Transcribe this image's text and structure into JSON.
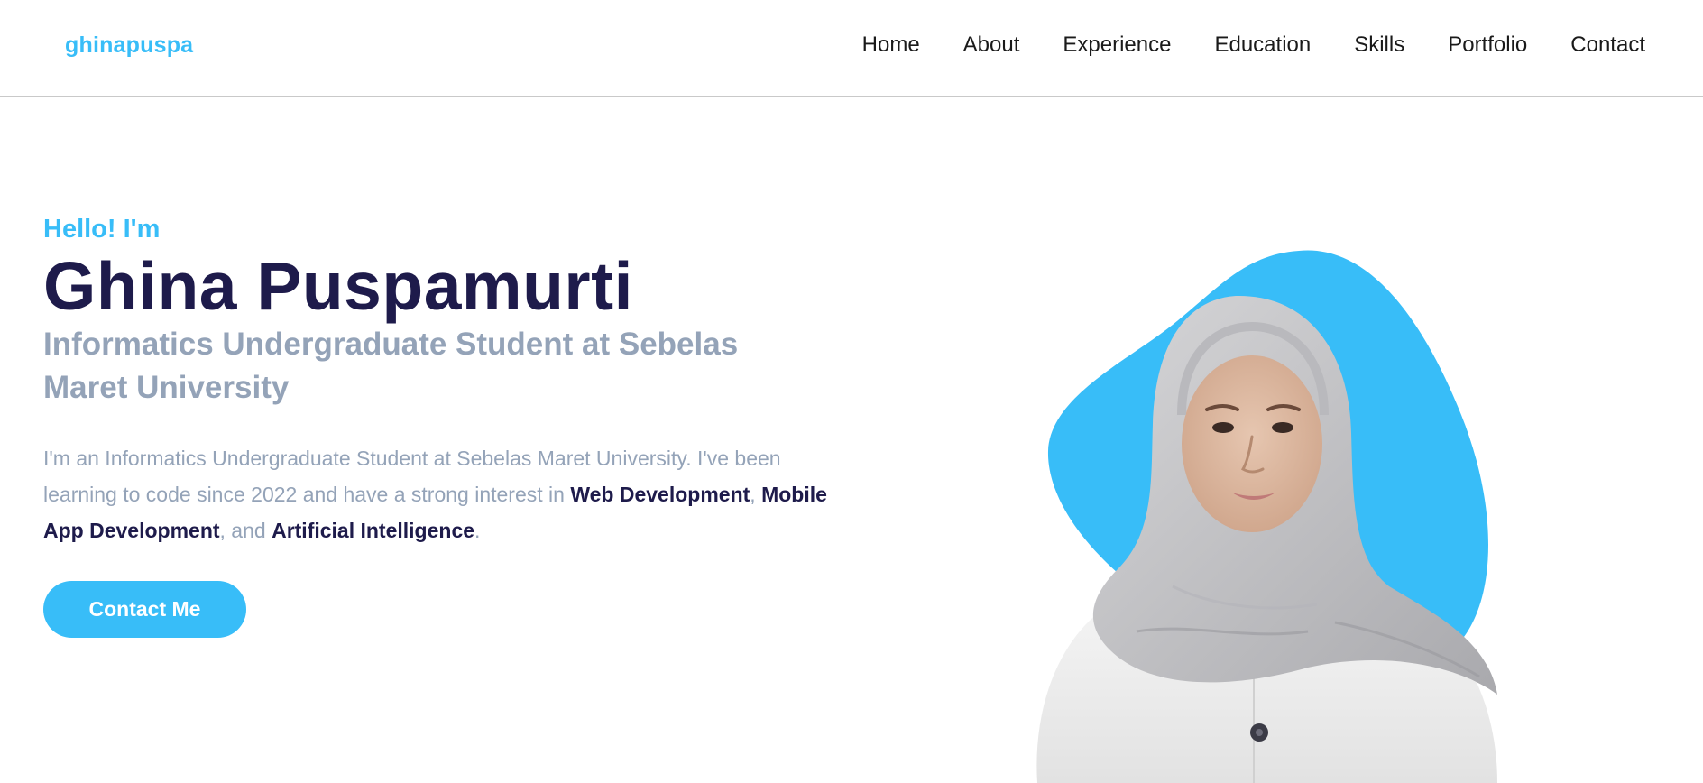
{
  "header": {
    "brand": "ghinapuspa",
    "nav": [
      "Home",
      "About",
      "Experience",
      "Education",
      "Skills",
      "Portfolio",
      "Contact"
    ]
  },
  "hero": {
    "greeting": "Hello! I'm",
    "name": "Ghina Puspamurti",
    "role": "Informatics Undergraduate Student at Sebelas Maret University",
    "intro": {
      "part1": "I'm an Informatics Undergraduate Student at Sebelas Maret University. I've been learning to code since 2022 and have a strong interest in ",
      "highlight1": "Web Development",
      "part2": ", ",
      "highlight2": "Mobile App Development",
      "part3": ", and ",
      "highlight3": "Artificial Intelligence",
      "part4": "."
    },
    "cta_label": "Contact Me"
  },
  "colors": {
    "accent": "#38bdf8",
    "heading": "#1e1b4b",
    "muted": "#94a3b8",
    "blob": "#38bdf8"
  },
  "icons": {
    "portrait": "portrait-photo"
  }
}
